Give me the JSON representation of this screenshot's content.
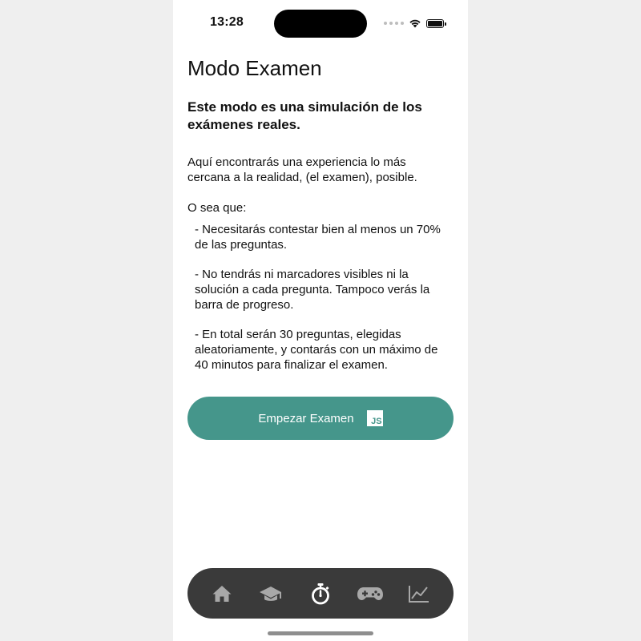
{
  "status_bar": {
    "time": "13:28"
  },
  "page": {
    "title": "Modo Examen",
    "subtitle": "Este modo es una simulación de los exámenes reales.",
    "intro": "Aquí encontrarás una experiencia lo más cercana a la realidad, (el examen), posible.",
    "so_label": "O sea que:",
    "rules": [
      "- Necesitarás contestar bien al menos un 70% de las preguntas.",
      "- No tendrás ni marcadores visibles ni la solución a cada pregunta. Tampoco verás la barra de progreso.",
      "- En total serán 30 preguntas, elegidas aleatoriamente, y contarás con un máximo de 40 minutos para finalizar el examen."
    ]
  },
  "start_button": {
    "label": "Empezar Examen",
    "icon": "js-icon",
    "icon_text": "JS",
    "color": "#45968b"
  },
  "tab_bar": {
    "background": "#3a3a3a",
    "active_color": "#ffffff",
    "inactive_color": "#a8a8a8",
    "tabs": [
      {
        "icon": "home-icon",
        "active": false
      },
      {
        "icon": "graduation-cap-icon",
        "active": false
      },
      {
        "icon": "stopwatch-icon",
        "active": true
      },
      {
        "icon": "gamepad-icon",
        "active": false
      },
      {
        "icon": "line-chart-icon",
        "active": false
      }
    ]
  }
}
